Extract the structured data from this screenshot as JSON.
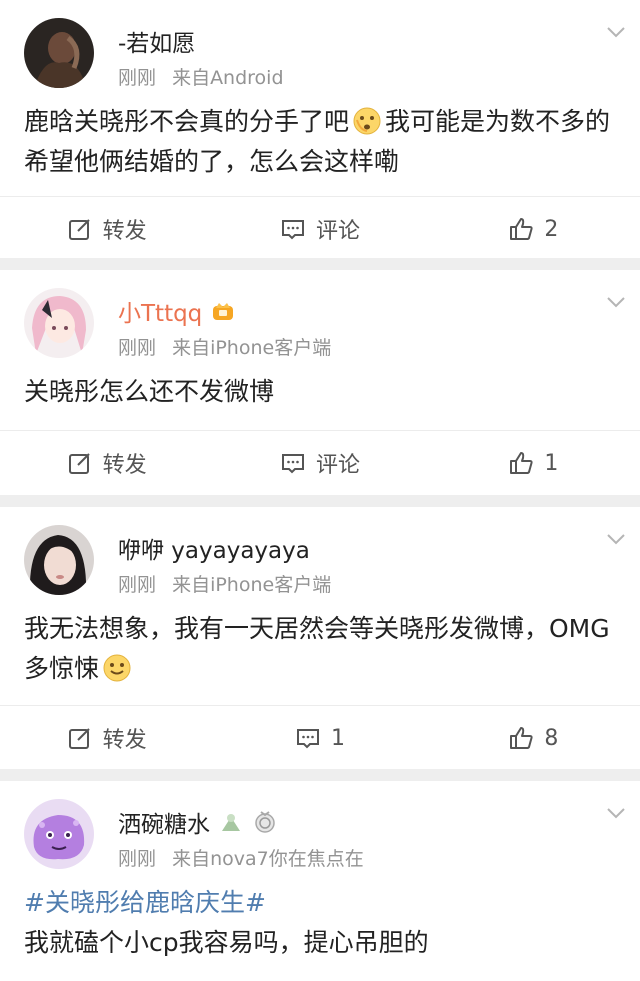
{
  "posts": [
    {
      "username": "-若如愿",
      "time": "刚刚",
      "source": "来自Android",
      "body_1": "鹿晗关晓彤不会真的分手了吧",
      "body_2": "我可能是为数不多的希望他俩结婚的了，怎么会这样嘞",
      "repost_label": "转发",
      "comment_label": "评论",
      "like_count": "2"
    },
    {
      "username": "小Tttqq",
      "time": "刚刚",
      "source": "来自iPhone客户端",
      "body": "关晓彤怎么还不发微博",
      "repost_label": "转发",
      "comment_label": "评论",
      "like_count": "1"
    },
    {
      "username": "咿咿 yayayayaya",
      "time": "刚刚",
      "source": "来自iPhone客户端",
      "body_1": "我无法想象，我有一天居然会等关晓彤发微博，OMG多惊悚",
      "repost_label": "转发",
      "comment_count": "1",
      "like_count": "8"
    },
    {
      "username": "洒碗糖水",
      "time": "刚刚",
      "source": "来自nova7你在焦点在",
      "hashtag": "#关晓彤给鹿晗庆生#",
      "body": "我就磕个小cp我容易吗，提心吊胆的"
    }
  ],
  "colors": {
    "vip_name": "#eb7350",
    "hashtag": "#507daf",
    "meta": "#939393"
  },
  "icons": {
    "repost": "edit-square-icon",
    "comment": "comment-box-icon",
    "like": "thumbs-up-icon",
    "menu": "chevron-down-icon"
  }
}
